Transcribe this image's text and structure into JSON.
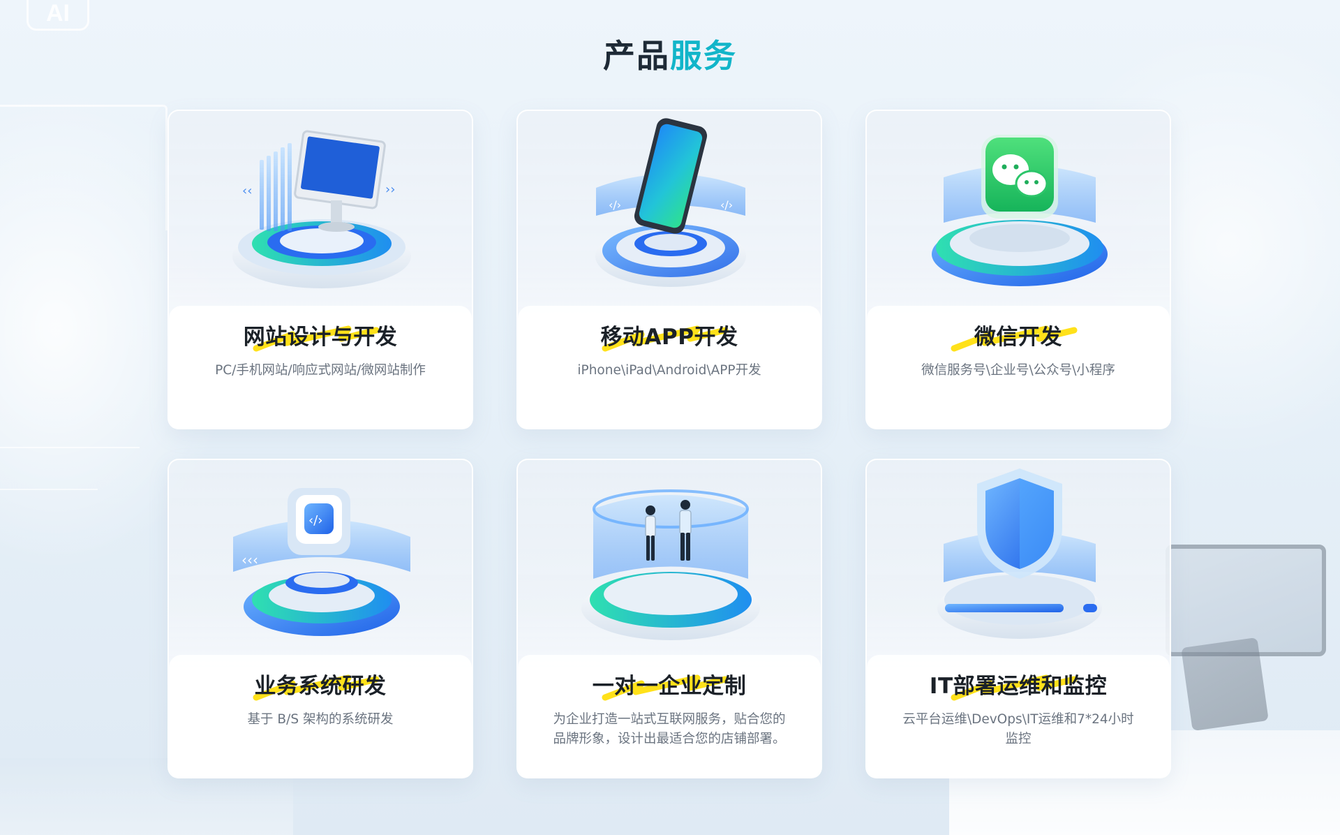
{
  "section": {
    "title_dark": "产品",
    "title_accent": "服务"
  },
  "background": {
    "logo_text": "AI"
  },
  "colors": {
    "accent": "#12b5c9",
    "highlight": "#ffe11a",
    "title": "#1e2a36"
  },
  "cards": [
    {
      "title": "网站设计与开发",
      "desc": "PC/手机网站/响应式网站/微网站制作",
      "icon": "desktop-monitor-icon"
    },
    {
      "title": "移动APP开发",
      "desc": "iPhone\\iPad\\Android\\APP开发",
      "icon": "smartphone-icon"
    },
    {
      "title": "微信开发",
      "desc": "微信服务号\\企业号\\公众号\\小程序",
      "icon": "wechat-icon"
    },
    {
      "title": "业务系统研发",
      "desc": "基于 B/S 架构的系统研发",
      "icon": "code-icon"
    },
    {
      "title": "一对一企业定制",
      "desc": "为企业打造一站式互联网服务，贴合您的品牌形象，设计出最适合您的店铺部署。",
      "icon": "consultation-icon"
    },
    {
      "title": "IT部署运维和监控",
      "desc": "云平台运维\\DevOps\\IT运维和7*24小时监控",
      "icon": "shield-icon"
    }
  ]
}
